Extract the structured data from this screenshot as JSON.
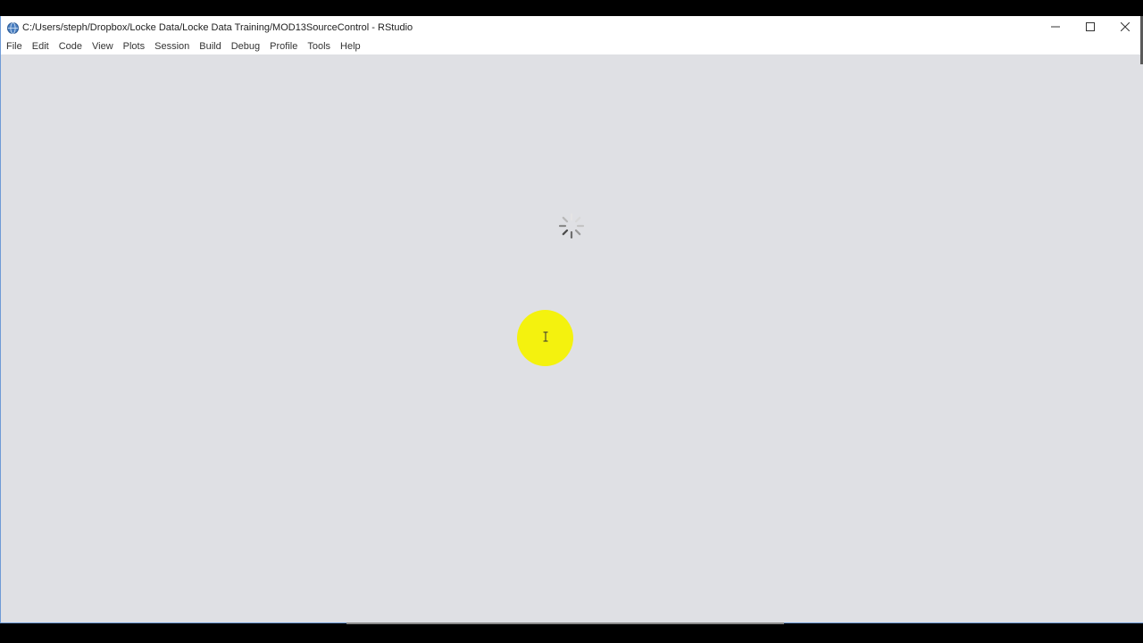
{
  "window": {
    "title": "C:/Users/steph/Dropbox/Locke Data/Locke Data Training/MOD13SourceControl - RStudio",
    "app_icon": "rstudio-globe-icon",
    "controls": {
      "minimize_icon": "minimize-icon",
      "maximize_icon": "maximize-icon",
      "close_icon": "close-icon"
    }
  },
  "menubar": {
    "items": [
      {
        "label": "File"
      },
      {
        "label": "Edit"
      },
      {
        "label": "Code"
      },
      {
        "label": "View"
      },
      {
        "label": "Plots"
      },
      {
        "label": "Session"
      },
      {
        "label": "Build"
      },
      {
        "label": "Debug"
      },
      {
        "label": "Profile"
      },
      {
        "label": "Tools"
      },
      {
        "label": "Help"
      }
    ]
  },
  "content": {
    "state": "loading",
    "spinner_icon": "loading-spinner-icon",
    "cursor_icon": "text-cursor-icon"
  },
  "colors": {
    "content_background": "#dfe0e4",
    "titlebar_background": "#ffffff",
    "cursor_highlight": "#f4f20e",
    "window_border": "#6f9bd6"
  }
}
